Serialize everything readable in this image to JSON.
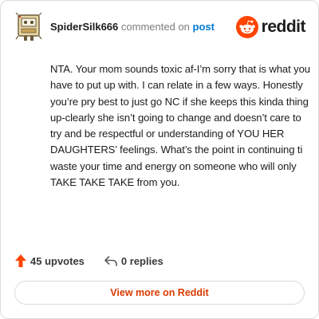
{
  "comment": {
    "username": "SpiderSilk666",
    "action": "commented on",
    "post_link": "post",
    "body": "NTA. Your mom sounds toxic af-I’m sorry that is what you have to put up with. I can relate in a few ways. Honestly you’re pry best to just go NC if she keeps this kinda thing up-clearly she isn’t going to change and doesn’t care to try and be respectful or understanding of YOU HER DAUGHTERS’ feelings. What’s the point in continuing ti waste your time and energy on someone who will only TAKE TAKE TAKE from you."
  },
  "brand": {
    "wordmark": "reddit",
    "logo_icon": "reddit-snoo-icon",
    "color": "#ff4500"
  },
  "footer": {
    "upvote_icon": "upvote-arrow-icon",
    "upvotes": "45 upvotes",
    "reply_icon": "reply-arrow-icon",
    "replies": "0 replies"
  },
  "cta": {
    "label": "View more on Reddit",
    "color": "#d93a00"
  }
}
